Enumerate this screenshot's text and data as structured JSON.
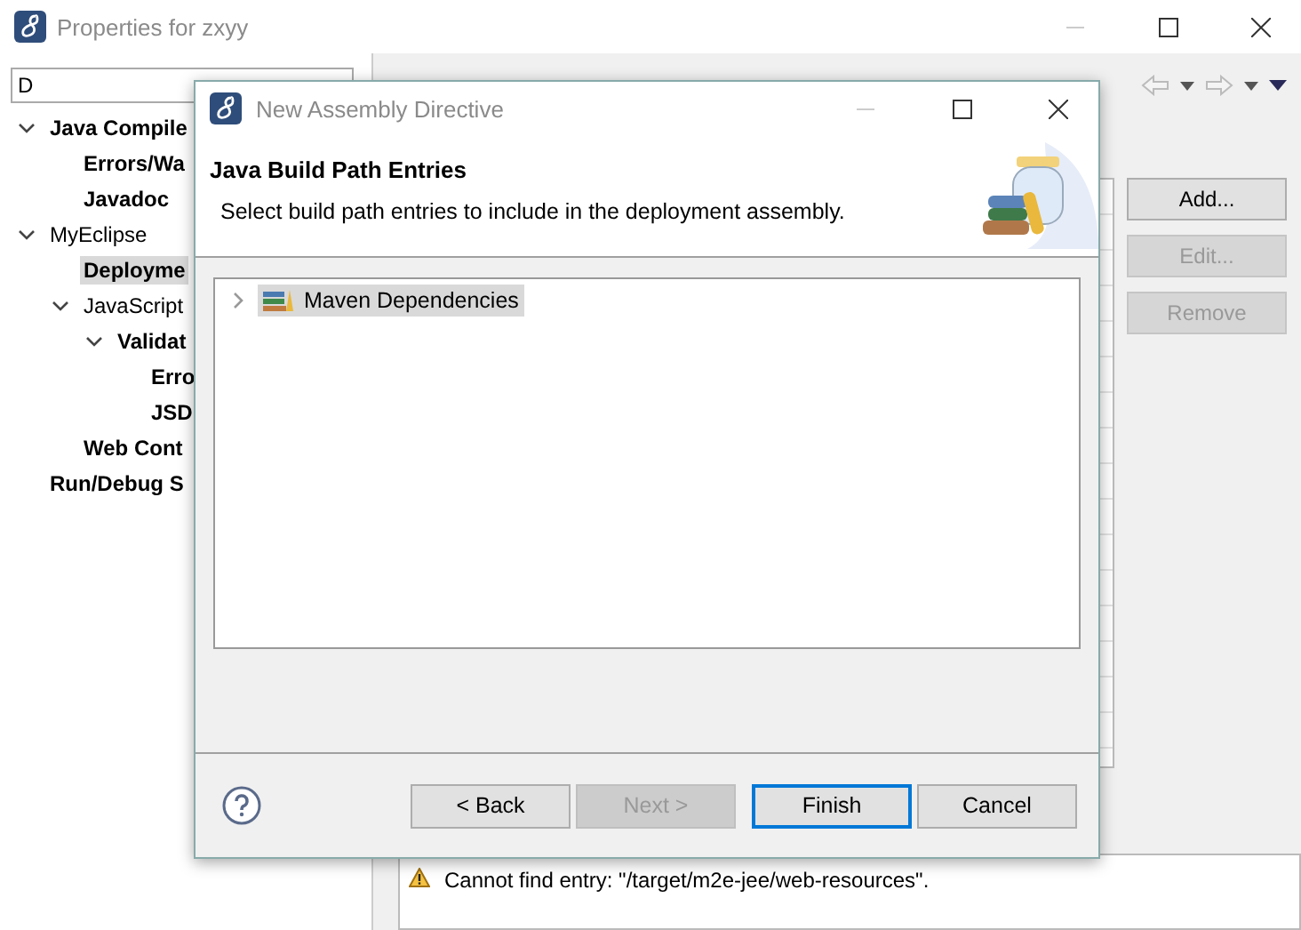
{
  "window": {
    "title": "Properties for zxyy"
  },
  "filter": {
    "value": "D"
  },
  "tree": [
    {
      "label": "Java Compile",
      "bold": true,
      "expanded": true,
      "selected": false,
      "children": [
        {
          "label": "Errors/Wa",
          "bold": true,
          "selected": false
        },
        {
          "label": "Javadoc",
          "bold": true,
          "selected": false
        }
      ]
    },
    {
      "label": "MyEclipse",
      "bold": false,
      "expanded": true,
      "selected": false,
      "children": [
        {
          "label": "Deployme",
          "bold": true,
          "selected": true
        },
        {
          "label": "JavaScript",
          "bold": false,
          "expanded": true,
          "selected": false,
          "children": [
            {
              "label": "Validat",
              "bold": true,
              "expanded": true,
              "selected": false,
              "children": [
                {
                  "label": "Erro",
                  "bold": true,
                  "selected": false
                },
                {
                  "label": "JSD",
                  "bold": true,
                  "selected": false
                }
              ]
            }
          ]
        },
        {
          "label": "Web Cont",
          "bold": true,
          "selected": false
        }
      ]
    },
    {
      "label": "Run/Debug S",
      "bold": true,
      "selected": false
    }
  ],
  "side_buttons": [
    {
      "label": "Add...",
      "disabled": false
    },
    {
      "label": "Edit...",
      "disabled": true
    },
    {
      "label": "Remove",
      "disabled": true
    }
  ],
  "message": "Cannot find entry: \"/target/m2e-jee/web-resources\".",
  "dialog": {
    "title": "New Assembly Directive",
    "heading": "Java Build Path Entries",
    "description": "Select build path entries to include in the deployment assembly.",
    "entries": [
      {
        "label": "Maven Dependencies",
        "expanded": false,
        "selected": true
      }
    ],
    "buttons": [
      {
        "label": "< Back",
        "disabled": false,
        "default": false
      },
      {
        "label": "Next >",
        "disabled": true,
        "default": false
      },
      {
        "label": "Finish",
        "disabled": false,
        "default": true
      },
      {
        "label": "Cancel",
        "disabled": false,
        "default": false
      }
    ]
  }
}
